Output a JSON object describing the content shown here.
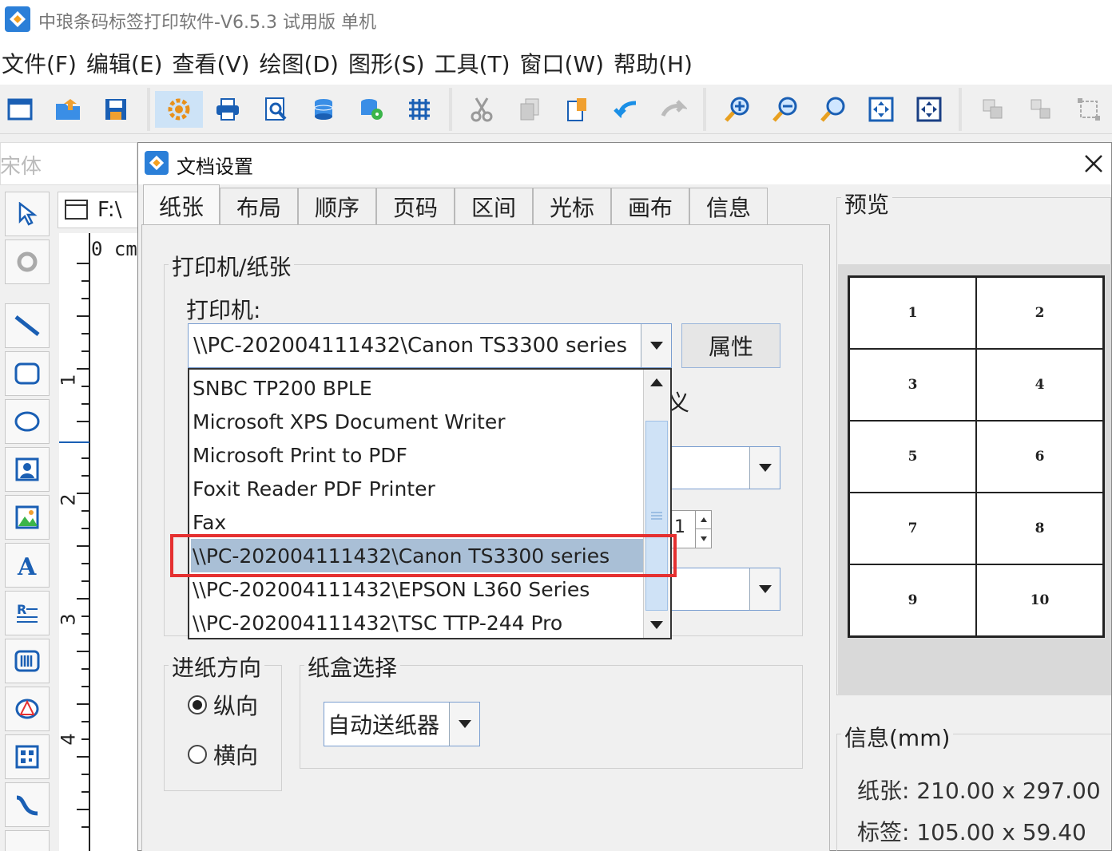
{
  "app": {
    "title": "中琅条码标签打印软件-V6.5.3 试用版 单机"
  },
  "menu": [
    "文件(F)",
    "编辑(E)",
    "查看(V)",
    "绘图(D)",
    "图形(S)",
    "工具(T)",
    "窗口(W)",
    "帮助(H)"
  ],
  "toolbar": {
    "icons": [
      "new-icon",
      "open-icon",
      "save-icon",
      "page-setup-icon",
      "print-icon",
      "print-preview-icon",
      "database-icon",
      "database-settings-icon",
      "grid-icon",
      "cut-icon",
      "copy-icon",
      "paste-icon",
      "undo-icon",
      "redo-icon",
      "zoom-in-icon",
      "zoom-out-icon",
      "zoom-actual-icon",
      "fit-page-icon",
      "fit-width-icon",
      "group-icon",
      "ungroup-icon",
      "align-icon"
    ]
  },
  "fontbar": {
    "font_name": "宋体"
  },
  "document": {
    "tab_label": "F:\\",
    "ruler_unit": "0 cm",
    "ruler_marks": [
      "1",
      "2",
      "3",
      "4"
    ]
  },
  "dialog": {
    "title": "文档设置",
    "tabs": [
      "纸张",
      "布局",
      "顺序",
      "页码",
      "区间",
      "光标",
      "画布",
      "信息"
    ],
    "active_tab": "纸张",
    "printer_group": {
      "title": "打印机/纸张",
      "printer_label": "打印机:",
      "printer_value": "\\\\PC-202004111432\\Canon TS3300 series",
      "properties_button": "属性",
      "printer_options": [
        "SNBC TP200 BPLE",
        "Microsoft XPS Document Writer",
        "Microsoft Print to PDF",
        "Foxit Reader PDF Printer",
        "Fax",
        "\\\\PC-202004111432\\Canon TS3300 series",
        "\\\\PC-202004111432\\EPSON L360 Series",
        "\\\\PC-202004111432\\TSC TTP-244 Pro"
      ],
      "selected_index": 5,
      "partial_char": "义",
      "spinner_value": "1"
    },
    "orientation_group": {
      "title": "进纸方向",
      "options": [
        "纵向",
        "横向"
      ],
      "selected": "纵向"
    },
    "tray_group": {
      "title": "纸盒选择",
      "value": "自动送纸器"
    },
    "preview": {
      "title": "预览",
      "cells": [
        "1",
        "2",
        "3",
        "4",
        "5",
        "6",
        "7",
        "8",
        "9",
        "10"
      ]
    },
    "info": {
      "title": "信息(mm)",
      "paper_label": "纸张:",
      "paper_value": "210.00 x 297.00",
      "label_label": "标签:",
      "label_value": "105.00 x 59.40"
    }
  },
  "colors": {
    "accent": "#2b7fd8",
    "selection": "#a9bfd6",
    "highlight": "#e53030"
  }
}
